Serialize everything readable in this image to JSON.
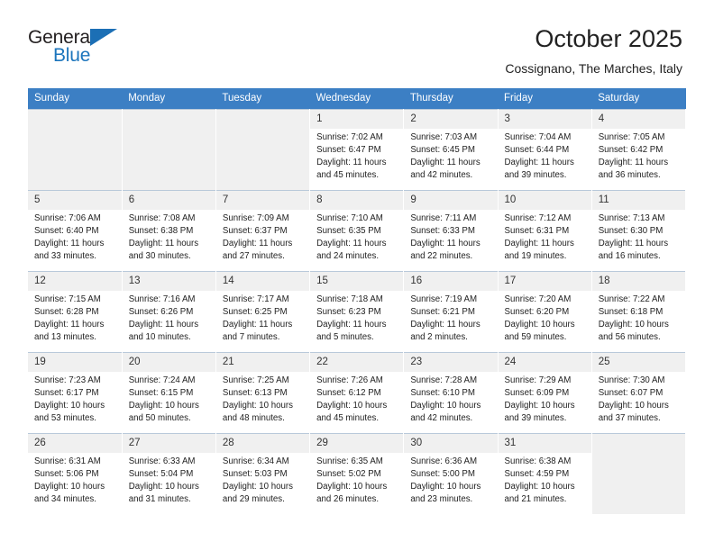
{
  "brand": {
    "name_line1": "General",
    "name_line2": "Blue",
    "logo_icon": "triangle-icon"
  },
  "header": {
    "title": "October 2025",
    "subtitle": "Cossignano, The Marches, Italy"
  },
  "calendar": {
    "weekdays": [
      "Sunday",
      "Monday",
      "Tuesday",
      "Wednesday",
      "Thursday",
      "Friday",
      "Saturday"
    ],
    "accent_color": "#3c7fc4",
    "daynum_bg": "#f0f0f0",
    "empty_bg": "#f0f0f0",
    "weeks": [
      [
        {
          "day": "",
          "empty": true
        },
        {
          "day": "",
          "empty": true
        },
        {
          "day": "",
          "empty": true
        },
        {
          "day": "1",
          "sunrise": "Sunrise: 7:02 AM",
          "sunset": "Sunset: 6:47 PM",
          "daylight": "Daylight: 11 hours and 45 minutes."
        },
        {
          "day": "2",
          "sunrise": "Sunrise: 7:03 AM",
          "sunset": "Sunset: 6:45 PM",
          "daylight": "Daylight: 11 hours and 42 minutes."
        },
        {
          "day": "3",
          "sunrise": "Sunrise: 7:04 AM",
          "sunset": "Sunset: 6:44 PM",
          "daylight": "Daylight: 11 hours and 39 minutes."
        },
        {
          "day": "4",
          "sunrise": "Sunrise: 7:05 AM",
          "sunset": "Sunset: 6:42 PM",
          "daylight": "Daylight: 11 hours and 36 minutes."
        }
      ],
      [
        {
          "day": "5",
          "sunrise": "Sunrise: 7:06 AM",
          "sunset": "Sunset: 6:40 PM",
          "daylight": "Daylight: 11 hours and 33 minutes."
        },
        {
          "day": "6",
          "sunrise": "Sunrise: 7:08 AM",
          "sunset": "Sunset: 6:38 PM",
          "daylight": "Daylight: 11 hours and 30 minutes."
        },
        {
          "day": "7",
          "sunrise": "Sunrise: 7:09 AM",
          "sunset": "Sunset: 6:37 PM",
          "daylight": "Daylight: 11 hours and 27 minutes."
        },
        {
          "day": "8",
          "sunrise": "Sunrise: 7:10 AM",
          "sunset": "Sunset: 6:35 PM",
          "daylight": "Daylight: 11 hours and 24 minutes."
        },
        {
          "day": "9",
          "sunrise": "Sunrise: 7:11 AM",
          "sunset": "Sunset: 6:33 PM",
          "daylight": "Daylight: 11 hours and 22 minutes."
        },
        {
          "day": "10",
          "sunrise": "Sunrise: 7:12 AM",
          "sunset": "Sunset: 6:31 PM",
          "daylight": "Daylight: 11 hours and 19 minutes."
        },
        {
          "day": "11",
          "sunrise": "Sunrise: 7:13 AM",
          "sunset": "Sunset: 6:30 PM",
          "daylight": "Daylight: 11 hours and 16 minutes."
        }
      ],
      [
        {
          "day": "12",
          "sunrise": "Sunrise: 7:15 AM",
          "sunset": "Sunset: 6:28 PM",
          "daylight": "Daylight: 11 hours and 13 minutes."
        },
        {
          "day": "13",
          "sunrise": "Sunrise: 7:16 AM",
          "sunset": "Sunset: 6:26 PM",
          "daylight": "Daylight: 11 hours and 10 minutes."
        },
        {
          "day": "14",
          "sunrise": "Sunrise: 7:17 AM",
          "sunset": "Sunset: 6:25 PM",
          "daylight": "Daylight: 11 hours and 7 minutes."
        },
        {
          "day": "15",
          "sunrise": "Sunrise: 7:18 AM",
          "sunset": "Sunset: 6:23 PM",
          "daylight": "Daylight: 11 hours and 5 minutes."
        },
        {
          "day": "16",
          "sunrise": "Sunrise: 7:19 AM",
          "sunset": "Sunset: 6:21 PM",
          "daylight": "Daylight: 11 hours and 2 minutes."
        },
        {
          "day": "17",
          "sunrise": "Sunrise: 7:20 AM",
          "sunset": "Sunset: 6:20 PM",
          "daylight": "Daylight: 10 hours and 59 minutes."
        },
        {
          "day": "18",
          "sunrise": "Sunrise: 7:22 AM",
          "sunset": "Sunset: 6:18 PM",
          "daylight": "Daylight: 10 hours and 56 minutes."
        }
      ],
      [
        {
          "day": "19",
          "sunrise": "Sunrise: 7:23 AM",
          "sunset": "Sunset: 6:17 PM",
          "daylight": "Daylight: 10 hours and 53 minutes."
        },
        {
          "day": "20",
          "sunrise": "Sunrise: 7:24 AM",
          "sunset": "Sunset: 6:15 PM",
          "daylight": "Daylight: 10 hours and 50 minutes."
        },
        {
          "day": "21",
          "sunrise": "Sunrise: 7:25 AM",
          "sunset": "Sunset: 6:13 PM",
          "daylight": "Daylight: 10 hours and 48 minutes."
        },
        {
          "day": "22",
          "sunrise": "Sunrise: 7:26 AM",
          "sunset": "Sunset: 6:12 PM",
          "daylight": "Daylight: 10 hours and 45 minutes."
        },
        {
          "day": "23",
          "sunrise": "Sunrise: 7:28 AM",
          "sunset": "Sunset: 6:10 PM",
          "daylight": "Daylight: 10 hours and 42 minutes."
        },
        {
          "day": "24",
          "sunrise": "Sunrise: 7:29 AM",
          "sunset": "Sunset: 6:09 PM",
          "daylight": "Daylight: 10 hours and 39 minutes."
        },
        {
          "day": "25",
          "sunrise": "Sunrise: 7:30 AM",
          "sunset": "Sunset: 6:07 PM",
          "daylight": "Daylight: 10 hours and 37 minutes."
        }
      ],
      [
        {
          "day": "26",
          "sunrise": "Sunrise: 6:31 AM",
          "sunset": "Sunset: 5:06 PM",
          "daylight": "Daylight: 10 hours and 34 minutes."
        },
        {
          "day": "27",
          "sunrise": "Sunrise: 6:33 AM",
          "sunset": "Sunset: 5:04 PM",
          "daylight": "Daylight: 10 hours and 31 minutes."
        },
        {
          "day": "28",
          "sunrise": "Sunrise: 6:34 AM",
          "sunset": "Sunset: 5:03 PM",
          "daylight": "Daylight: 10 hours and 29 minutes."
        },
        {
          "day": "29",
          "sunrise": "Sunrise: 6:35 AM",
          "sunset": "Sunset: 5:02 PM",
          "daylight": "Daylight: 10 hours and 26 minutes."
        },
        {
          "day": "30",
          "sunrise": "Sunrise: 6:36 AM",
          "sunset": "Sunset: 5:00 PM",
          "daylight": "Daylight: 10 hours and 23 minutes."
        },
        {
          "day": "31",
          "sunrise": "Sunrise: 6:38 AM",
          "sunset": "Sunset: 4:59 PM",
          "daylight": "Daylight: 10 hours and 21 minutes."
        },
        {
          "day": "",
          "empty": true
        }
      ]
    ]
  }
}
